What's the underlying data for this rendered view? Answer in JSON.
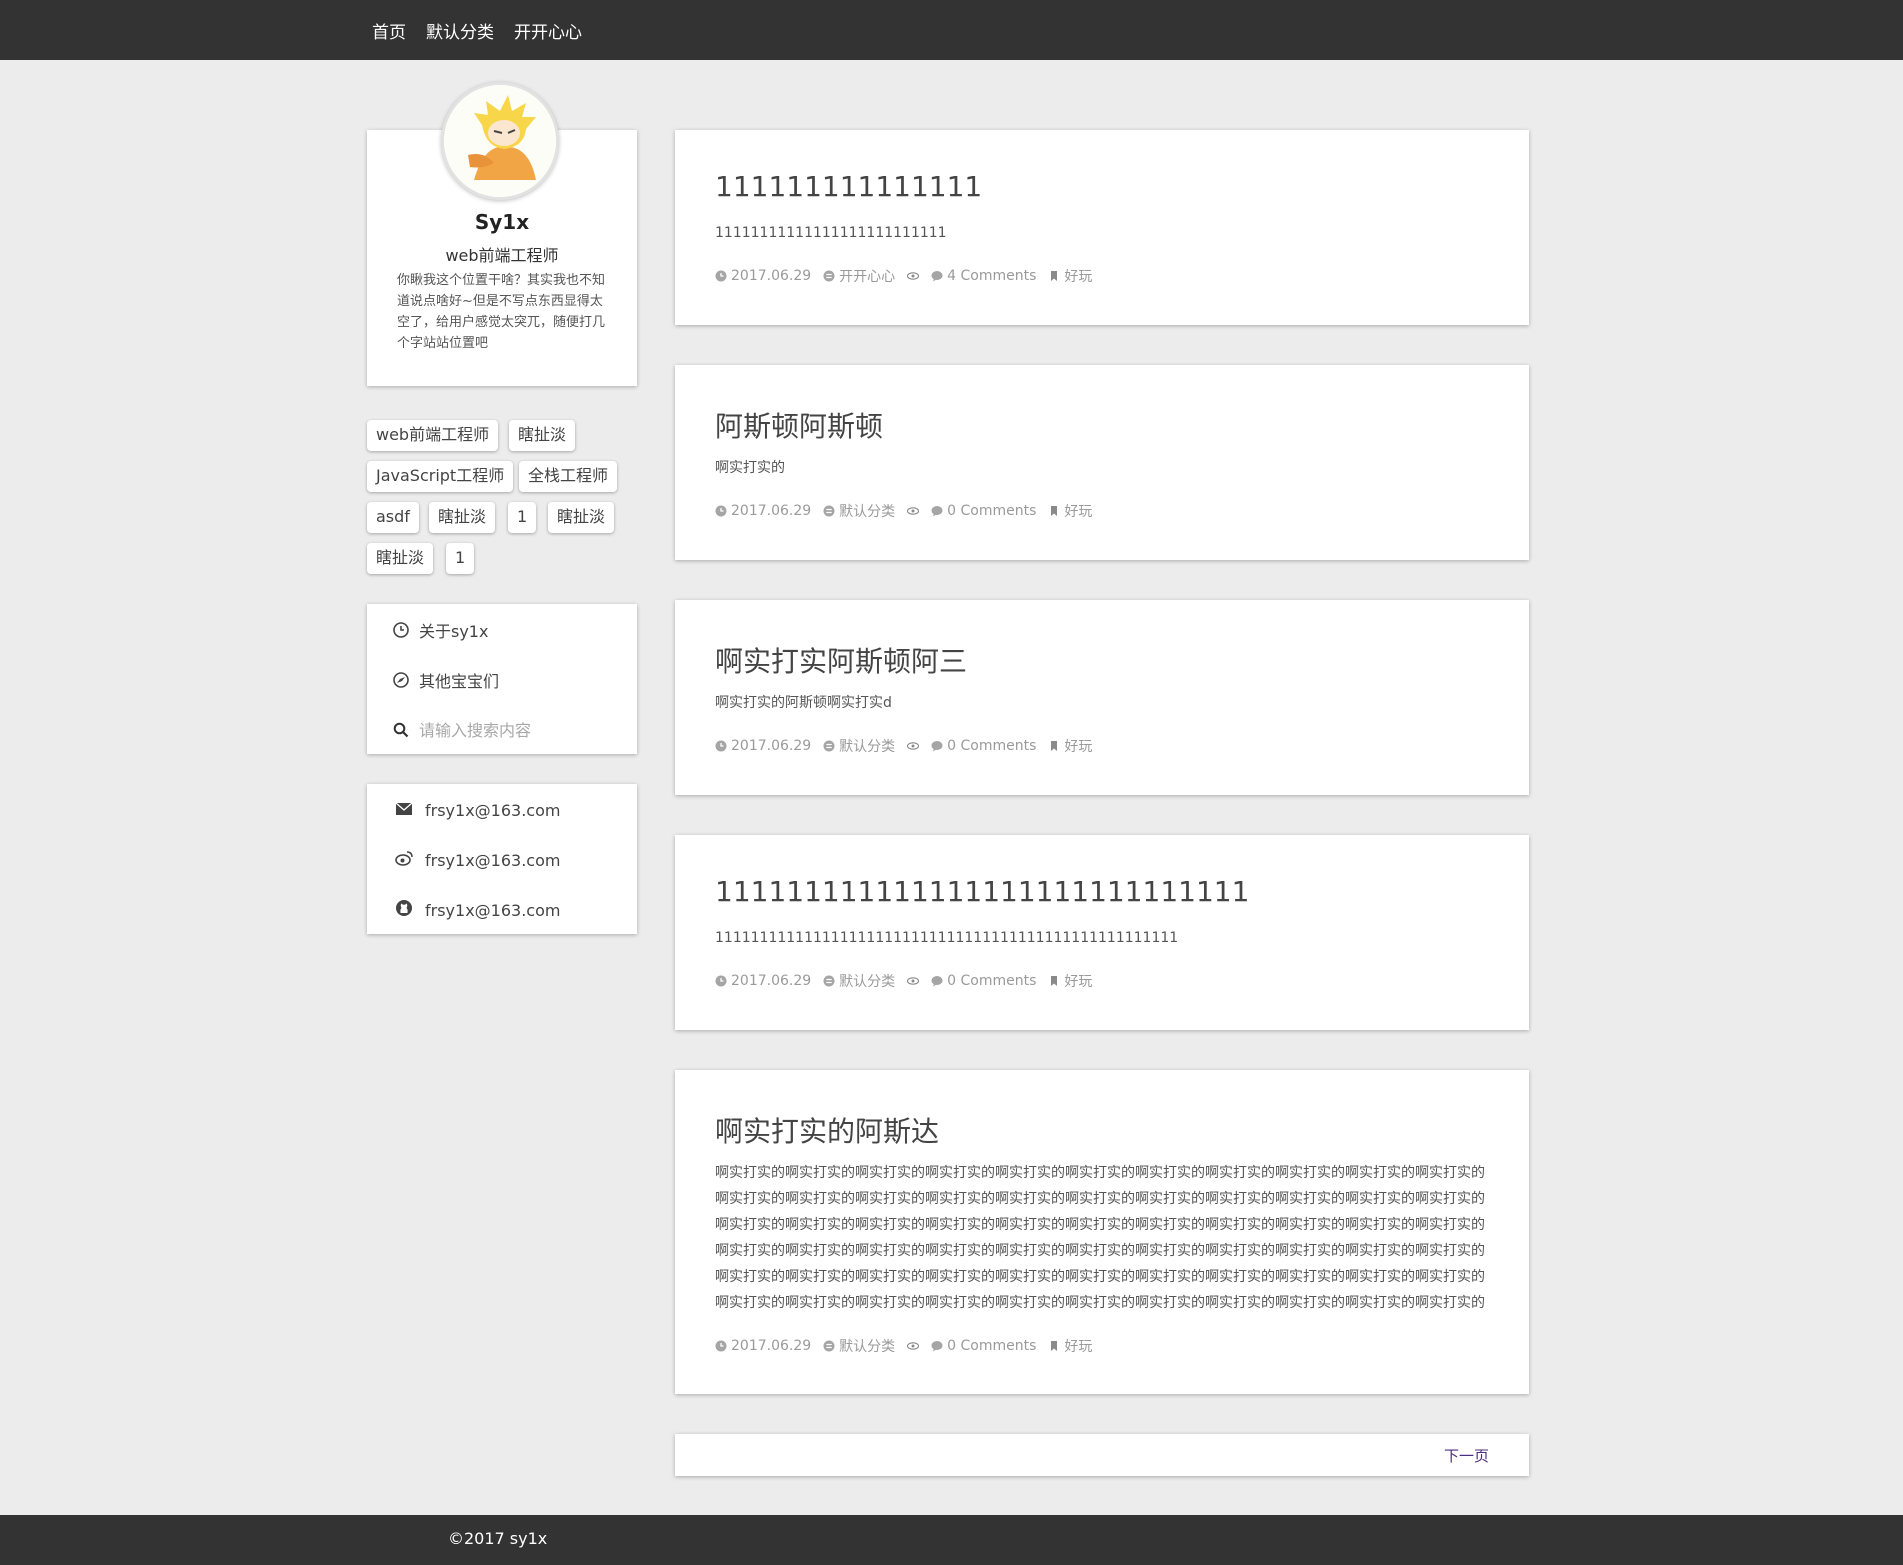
{
  "nav": {
    "items": [
      "首页",
      "默认分类",
      "开开心心"
    ]
  },
  "profile": {
    "name": "Sy1x",
    "role": "web前端工程师",
    "bio": "你瞅我这个位置干啥？其实我也不知道说点啥好~但是不写点东西显得太空了，给用户感觉太突兀，随便打几个字站站位置吧"
  },
  "tags": [
    "web前端工程师",
    "瞎扯淡",
    "JavaScript工程师",
    "全栈工程师",
    "asdf",
    "瞎扯淡",
    "1",
    "瞎扯淡",
    "瞎扯淡",
    "1"
  ],
  "menu": {
    "about": "关于sy1x",
    "others": "其他宝宝们",
    "search_placeholder": "请输入搜索内容"
  },
  "contacts": {
    "email": "frsy1x@163.com",
    "weibo": "frsy1x@163.com",
    "github": "frsy1x@163.com"
  },
  "posts": [
    {
      "title": "111111111111111",
      "excerpt": "11111111111111111111111111",
      "date": "2017.06.29",
      "category": "开开心心",
      "comments": "4 Comments",
      "tag": "好玩"
    },
    {
      "title": "阿斯顿阿斯顿",
      "excerpt": "啊实打实的",
      "date": "2017.06.29",
      "category": "默认分类",
      "comments": "0 Comments",
      "tag": "好玩"
    },
    {
      "title": "啊实打实阿斯顿阿三",
      "excerpt": "啊实打实的阿斯顿啊实打实d",
      "date": "2017.06.29",
      "category": "默认分类",
      "comments": "0 Comments",
      "tag": "好玩"
    },
    {
      "title": "111111111111111111111111111111",
      "excerpt": "1111111111111111111111111111111111111111111111111111",
      "date": "2017.06.29",
      "category": "默认分类",
      "comments": "0 Comments",
      "tag": "好玩"
    },
    {
      "title": "啊实打实的阿斯达",
      "excerpt": "啊实打实的啊实打实的啊实打实的啊实打实的啊实打实的啊实打实的啊实打实的啊实打实的啊实打实的啊实打实的啊实打实的啊实打实的啊实打实的啊实打实的啊实打实的啊实打实的啊实打实的啊实打实的啊实打实的啊实打实的啊实打实的啊实打实的啊实打实的啊实打实的啊实打实的啊实打实的啊实打实的啊实打实的啊实打实的啊实打实的啊实打实的啊实打实的啊实打实的啊实打实的啊实打实的啊实打实的啊实打实的啊实打实的啊实打实的啊实打实的啊实打实的啊实打实的啊实打实的啊实打实的啊实打实的啊实打实的啊实打实的啊实打实的啊实打实的啊实打实的啊实打实的啊实打实的啊实打实的啊实打实的啊实打实的啊实打实的啊实打实的啊实打实的啊实打实的啊实打实的啊实打实的啊实打实的啊实打实的啊实打实的啊实打实的啊实打实的啊实打实的啊实打实的啊实打实的啊实打......",
      "date": "2017.06.29",
      "category": "默认分类",
      "comments": "0 Comments",
      "tag": "好玩"
    }
  ],
  "pager": {
    "next": "下一页"
  },
  "footer": {
    "copyright": "©2017 sy1x"
  },
  "colors": {
    "topbar": "#333333",
    "background": "#ececec",
    "card": "#ffffff",
    "link": "#4b2e82",
    "meta": "#9a9a9a"
  }
}
